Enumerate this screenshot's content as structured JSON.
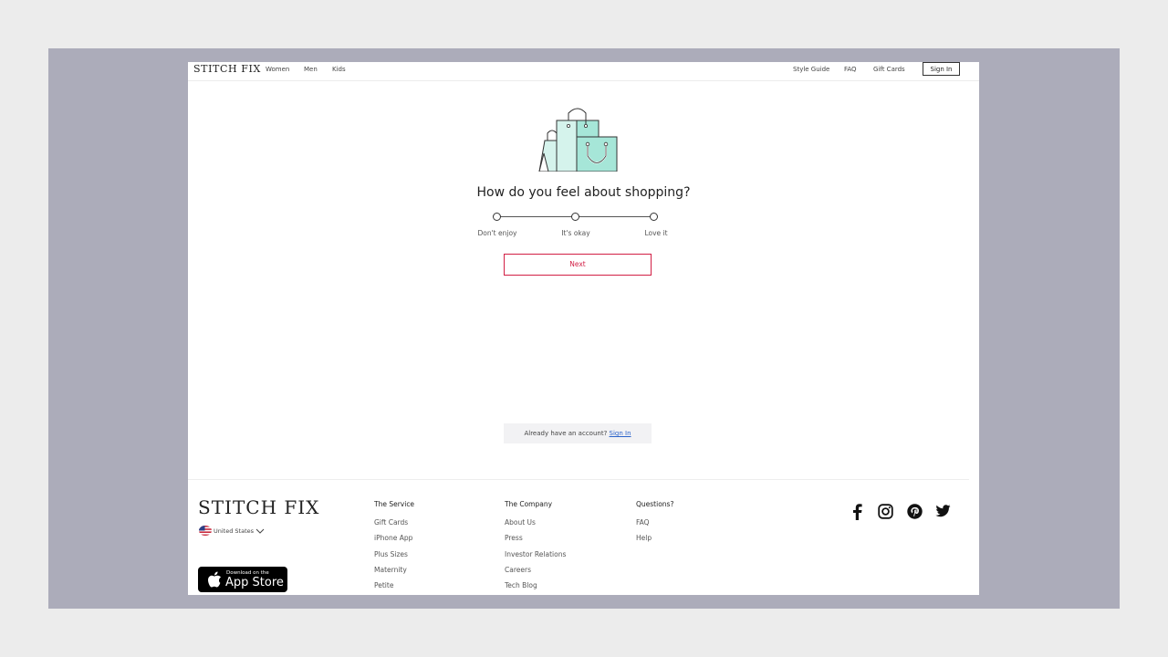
{
  "header": {
    "logo": "STITCH FIX",
    "nav_left": [
      "Women",
      "Men",
      "Kids"
    ],
    "nav_right": [
      "Style Guide",
      "FAQ",
      "Gift Cards"
    ],
    "signin": "Sign In"
  },
  "main": {
    "question": "How do you feel about shopping?",
    "slider_labels": [
      "Don't enjoy",
      "It's okay",
      "Love it"
    ],
    "next_label": "Next",
    "already_text": "Already have an account?",
    "already_link": "Sign In"
  },
  "footer": {
    "logo": "STITCH FIX",
    "country": "United States",
    "appstore_small": "Download on the",
    "appstore_big": "App Store",
    "columns": [
      {
        "heading": "The Service",
        "items": [
          "Gift Cards",
          "iPhone App",
          "Plus Sizes",
          "Maternity",
          "Petite"
        ]
      },
      {
        "heading": "The Company",
        "items": [
          "About Us",
          "Press",
          "Investor Relations",
          "Careers",
          "Tech Blog"
        ]
      },
      {
        "heading": "Questions?",
        "items": [
          "FAQ",
          "Help"
        ]
      }
    ],
    "social_icons": [
      "facebook-icon",
      "instagram-icon",
      "pinterest-icon",
      "twitter-icon"
    ]
  },
  "colors": {
    "accent": "#d21f45",
    "illustration_fill": "#a6e6d8",
    "frame_bg": "#acacba"
  }
}
